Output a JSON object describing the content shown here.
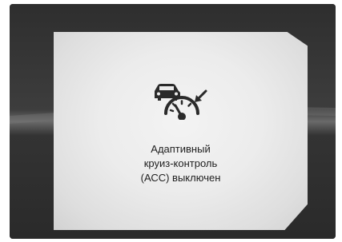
{
  "screen": {
    "icon": "adaptive-cruise-control-off-icon",
    "message_lines": [
      "Адаптивный",
      "круиз-контроль",
      "(АСС) выключен"
    ]
  },
  "colors": {
    "background": "#3a3a3a",
    "panel": "#ececec",
    "text": "#1e1e1e",
    "icon": "#2a2a2a"
  }
}
